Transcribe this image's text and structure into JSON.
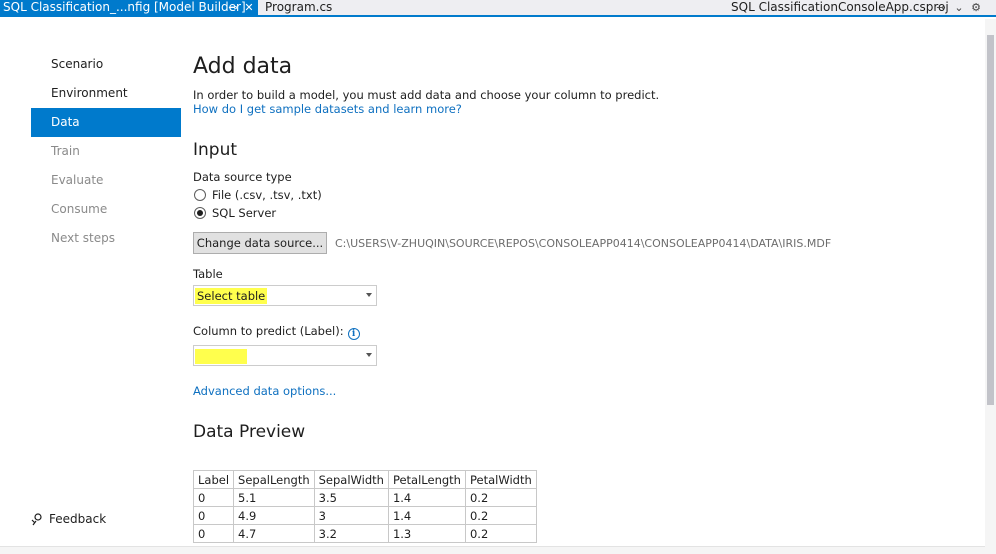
{
  "tabs": {
    "active_label": "SQL Classification_...nfig [Model Builder]",
    "second_label": "Program.cs",
    "project_label": "SQL ClassificationConsoleApp.csproj"
  },
  "sidebar": {
    "items": [
      {
        "label": "Scenario",
        "state": "normal"
      },
      {
        "label": "Environment",
        "state": "normal"
      },
      {
        "label": "Data",
        "state": "active"
      },
      {
        "label": "Train",
        "state": "disabled"
      },
      {
        "label": "Evaluate",
        "state": "disabled"
      },
      {
        "label": "Consume",
        "state": "disabled"
      },
      {
        "label": "Next steps",
        "state": "disabled"
      }
    ],
    "feedback_label": "Feedback"
  },
  "main": {
    "title": "Add data",
    "description": "In order to build a model, you must add data and choose your column to predict.",
    "help_link": "How do I get sample datasets and learn more?",
    "input_heading": "Input",
    "source_type_label": "Data source type",
    "source_options": [
      {
        "label": "File (.csv, .tsv, .txt)",
        "checked": false
      },
      {
        "label": "SQL Server",
        "checked": true
      }
    ],
    "change_source_button": "Change data source...",
    "source_path": "C:\\USERS\\V-ZHUQIN\\SOURCE\\REPOS\\CONSOLEAPP0414\\CONSOLEAPP0414\\DATA\\IRIS.MDF",
    "table_label": "Table",
    "table_select_value": "Select table",
    "label_column_label": "Column to predict (Label):",
    "label_column_value": "",
    "advanced_link": "Advanced data options...",
    "preview_heading": "Data Preview"
  },
  "preview": {
    "columns": [
      "Label",
      "SepalLength",
      "SepalWidth",
      "PetalLength",
      "PetalWidth"
    ],
    "rows": [
      [
        "0",
        "5.1",
        "3.5",
        "1.4",
        "0.2"
      ],
      [
        "0",
        "4.9",
        "3",
        "1.4",
        "0.2"
      ],
      [
        "0",
        "4.7",
        "3.2",
        "1.3",
        "0.2"
      ]
    ]
  },
  "colors": {
    "accent": "#007acc",
    "highlight": "#ffff4d",
    "link": "#0e70c0"
  },
  "icons": [
    "pin-icon",
    "close-icon",
    "dropdown-icon",
    "settings-icon",
    "info-icon",
    "feedback-icon",
    "chevron-down-icon"
  ]
}
